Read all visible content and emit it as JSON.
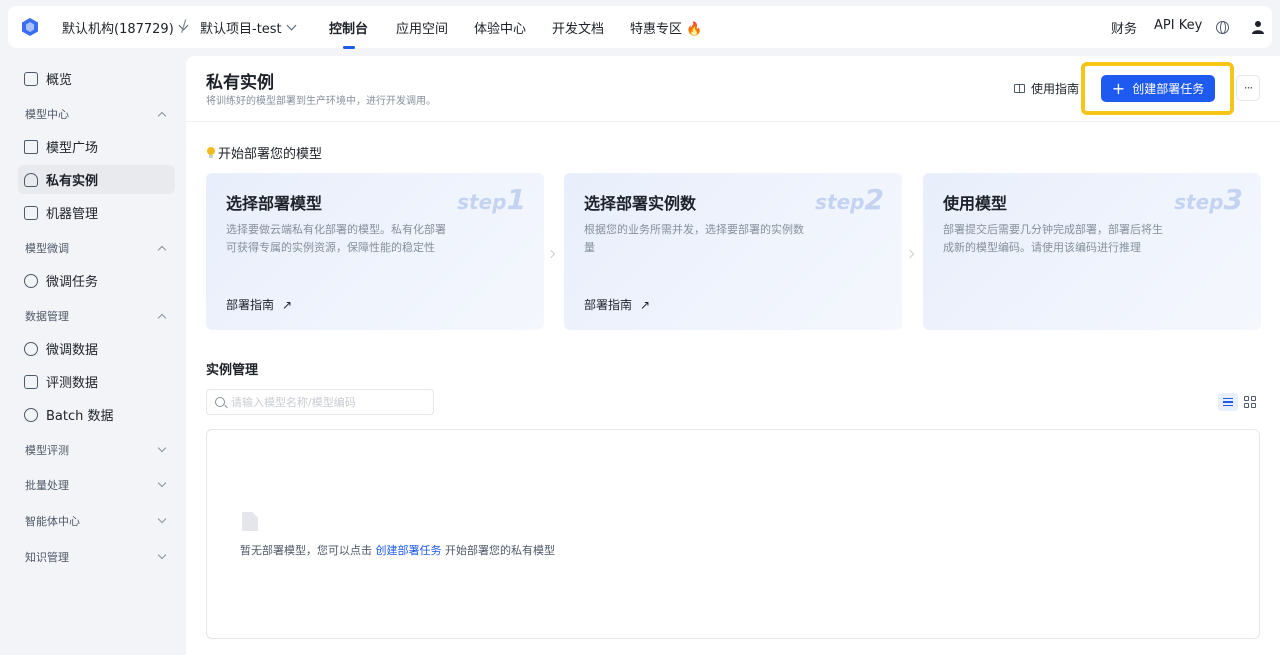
{
  "topbar": {
    "org_label": "默认机构(187729)",
    "separator": "/",
    "project_label": "默认项目-test",
    "tabs": [
      {
        "label": "控制台",
        "active": true
      },
      {
        "label": "应用空间",
        "active": false
      },
      {
        "label": "体验中心",
        "active": false
      },
      {
        "label": "开发文档",
        "active": false
      },
      {
        "label": "特惠专区 🔥",
        "active": false
      }
    ],
    "right": {
      "finance": "财务",
      "api_key": "API Key",
      "globe_icon": "globe-icon",
      "user_icon": "user-icon"
    }
  },
  "sidebar": {
    "overview": "概览",
    "groups": [
      {
        "label": "模型中心",
        "expanded": true,
        "items": [
          "模型广场",
          "私有实例",
          "机器管理"
        ]
      },
      {
        "label": "模型微调",
        "expanded": true,
        "items": [
          "微调任务"
        ]
      },
      {
        "label": "数据管理",
        "expanded": true,
        "items": [
          "微调数据",
          "评测数据",
          "Batch 数据"
        ]
      },
      {
        "label": "模型评测",
        "expanded": false
      },
      {
        "label": "批量处理",
        "expanded": false
      },
      {
        "label": "智能体中心",
        "expanded": false
      },
      {
        "label": "知识管理",
        "expanded": false
      }
    ],
    "active_item": "私有实例"
  },
  "header": {
    "title": "私有实例",
    "subtitle": "将训练好的模型部署到生产环境中，进行开发调用。",
    "guide_label": "使用指南",
    "create_label": "创建部署任务",
    "more_label": "···"
  },
  "start": {
    "title": "开始部署您的模型",
    "cards": [
      {
        "title": "选择部署模型",
        "step_word": "step",
        "step_num": "1",
        "desc": "选择要做云端私有化部署的模型。私有化部署可获得专属的实例资源，保障性能的稳定性",
        "link": "部署指南",
        "link_arrow": "↗"
      },
      {
        "title": "选择部署实例数",
        "step_word": "step",
        "step_num": "2",
        "desc": "根据您的业务所需并发，选择要部署的实例数量",
        "link": "部署指南",
        "link_arrow": "↗"
      },
      {
        "title": "使用模型",
        "step_word": "step",
        "step_num": "3",
        "desc": "部署提交后需要几分钟完成部署，部署后将生成新的模型编码。请使用该编码进行推理",
        "link": "",
        "link_arrow": ""
      }
    ]
  },
  "instances": {
    "title": "实例管理",
    "search_placeholder": "请输入模型名称/模型编码",
    "empty_prefix": "暂无部署模型，您可以点击",
    "empty_link": "创建部署任务",
    "empty_suffix": "开始部署您的私有模型"
  },
  "colors": {
    "accent": "#1f5af0",
    "highlight": "#f5c518"
  }
}
